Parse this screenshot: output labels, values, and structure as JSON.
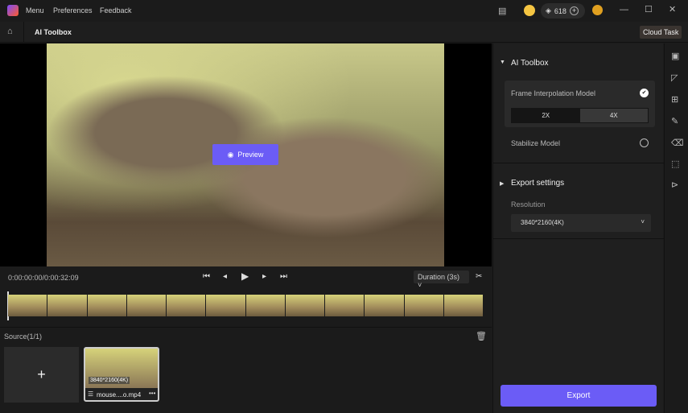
{
  "titlebar": {
    "menu": "Menu",
    "preferences": "Preferences",
    "feedback": "Feedback",
    "credits": "618"
  },
  "subbar": {
    "title": "AI Toolbox",
    "cloud_task": "Cloud Task"
  },
  "preview": {
    "button": "Preview"
  },
  "player": {
    "timecode": "0:00:00:00/0:00:32:09",
    "duration": "Duration (3s)"
  },
  "source": {
    "title": "Source(1/1)",
    "clip": {
      "resolution": "3840*2160(4K)",
      "name": "mouse....o.mp4"
    }
  },
  "panel": {
    "section_ai": "AI Toolbox",
    "frame_model": "Frame Interpolation Model",
    "options": [
      "2X",
      "4X"
    ],
    "selected": "4X",
    "stabilize": "Stabilize Model",
    "section_export": "Export settings",
    "resolution_label": "Resolution",
    "resolution_value": "3840*2160(4K)",
    "export": "Export"
  },
  "colors": {
    "accent": "#6b5cf6"
  }
}
